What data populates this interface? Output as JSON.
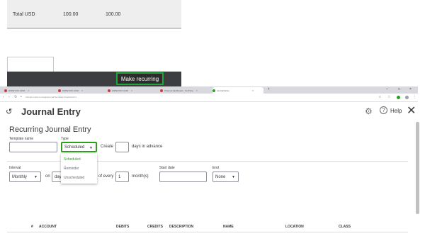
{
  "totals": {
    "label": "Total USD",
    "debits": "100.00",
    "credits": "100.00"
  },
  "make_recurring": "Make recurring",
  "browser": {
    "tabs": [
      {
        "label": "WWW.XXX.COM"
      },
      {
        "label": "WWW.XXX.COM"
      },
      {
        "label": "WWW.XXX.COM"
      },
      {
        "label": "Channel dashboard - YouTube"
      },
      {
        "label": "Journal Entry"
      }
    ],
    "url": "c23.qbo.intuit.com/app/journal?template=true&txnId=1"
  },
  "page": {
    "title": "Journal Entry",
    "help_label": "Help"
  },
  "recurring": {
    "title": "Recurring Journal Entry",
    "template_name_label": "Template name",
    "template_name_value": "",
    "type_label": "Type",
    "type_value": "Scheduled",
    "create_label": "Create",
    "create_days_value": "",
    "days_in_advance_label": "days in advance",
    "type_options": [
      "Scheduled",
      "Reminder",
      "Unscheduled"
    ],
    "interval_label": "Interval",
    "interval_value": "Monthly",
    "on_label": "on",
    "day_value": "day",
    "of_every_label": "of every",
    "months_value": "1",
    "months_label": "month(s)",
    "start_date_label": "Start date",
    "start_date_value": "",
    "end_label": "End",
    "end_value": "None"
  },
  "table": {
    "headers": [
      "#",
      "ACCOUNT",
      "DEBITS",
      "CREDITS",
      "DESCRIPTION",
      "NAME",
      "LOCATION",
      "CLASS"
    ]
  },
  "colors": {
    "accent": "#2ca01c",
    "dark_bar": "#3b3d40",
    "text": "#393a3d"
  }
}
